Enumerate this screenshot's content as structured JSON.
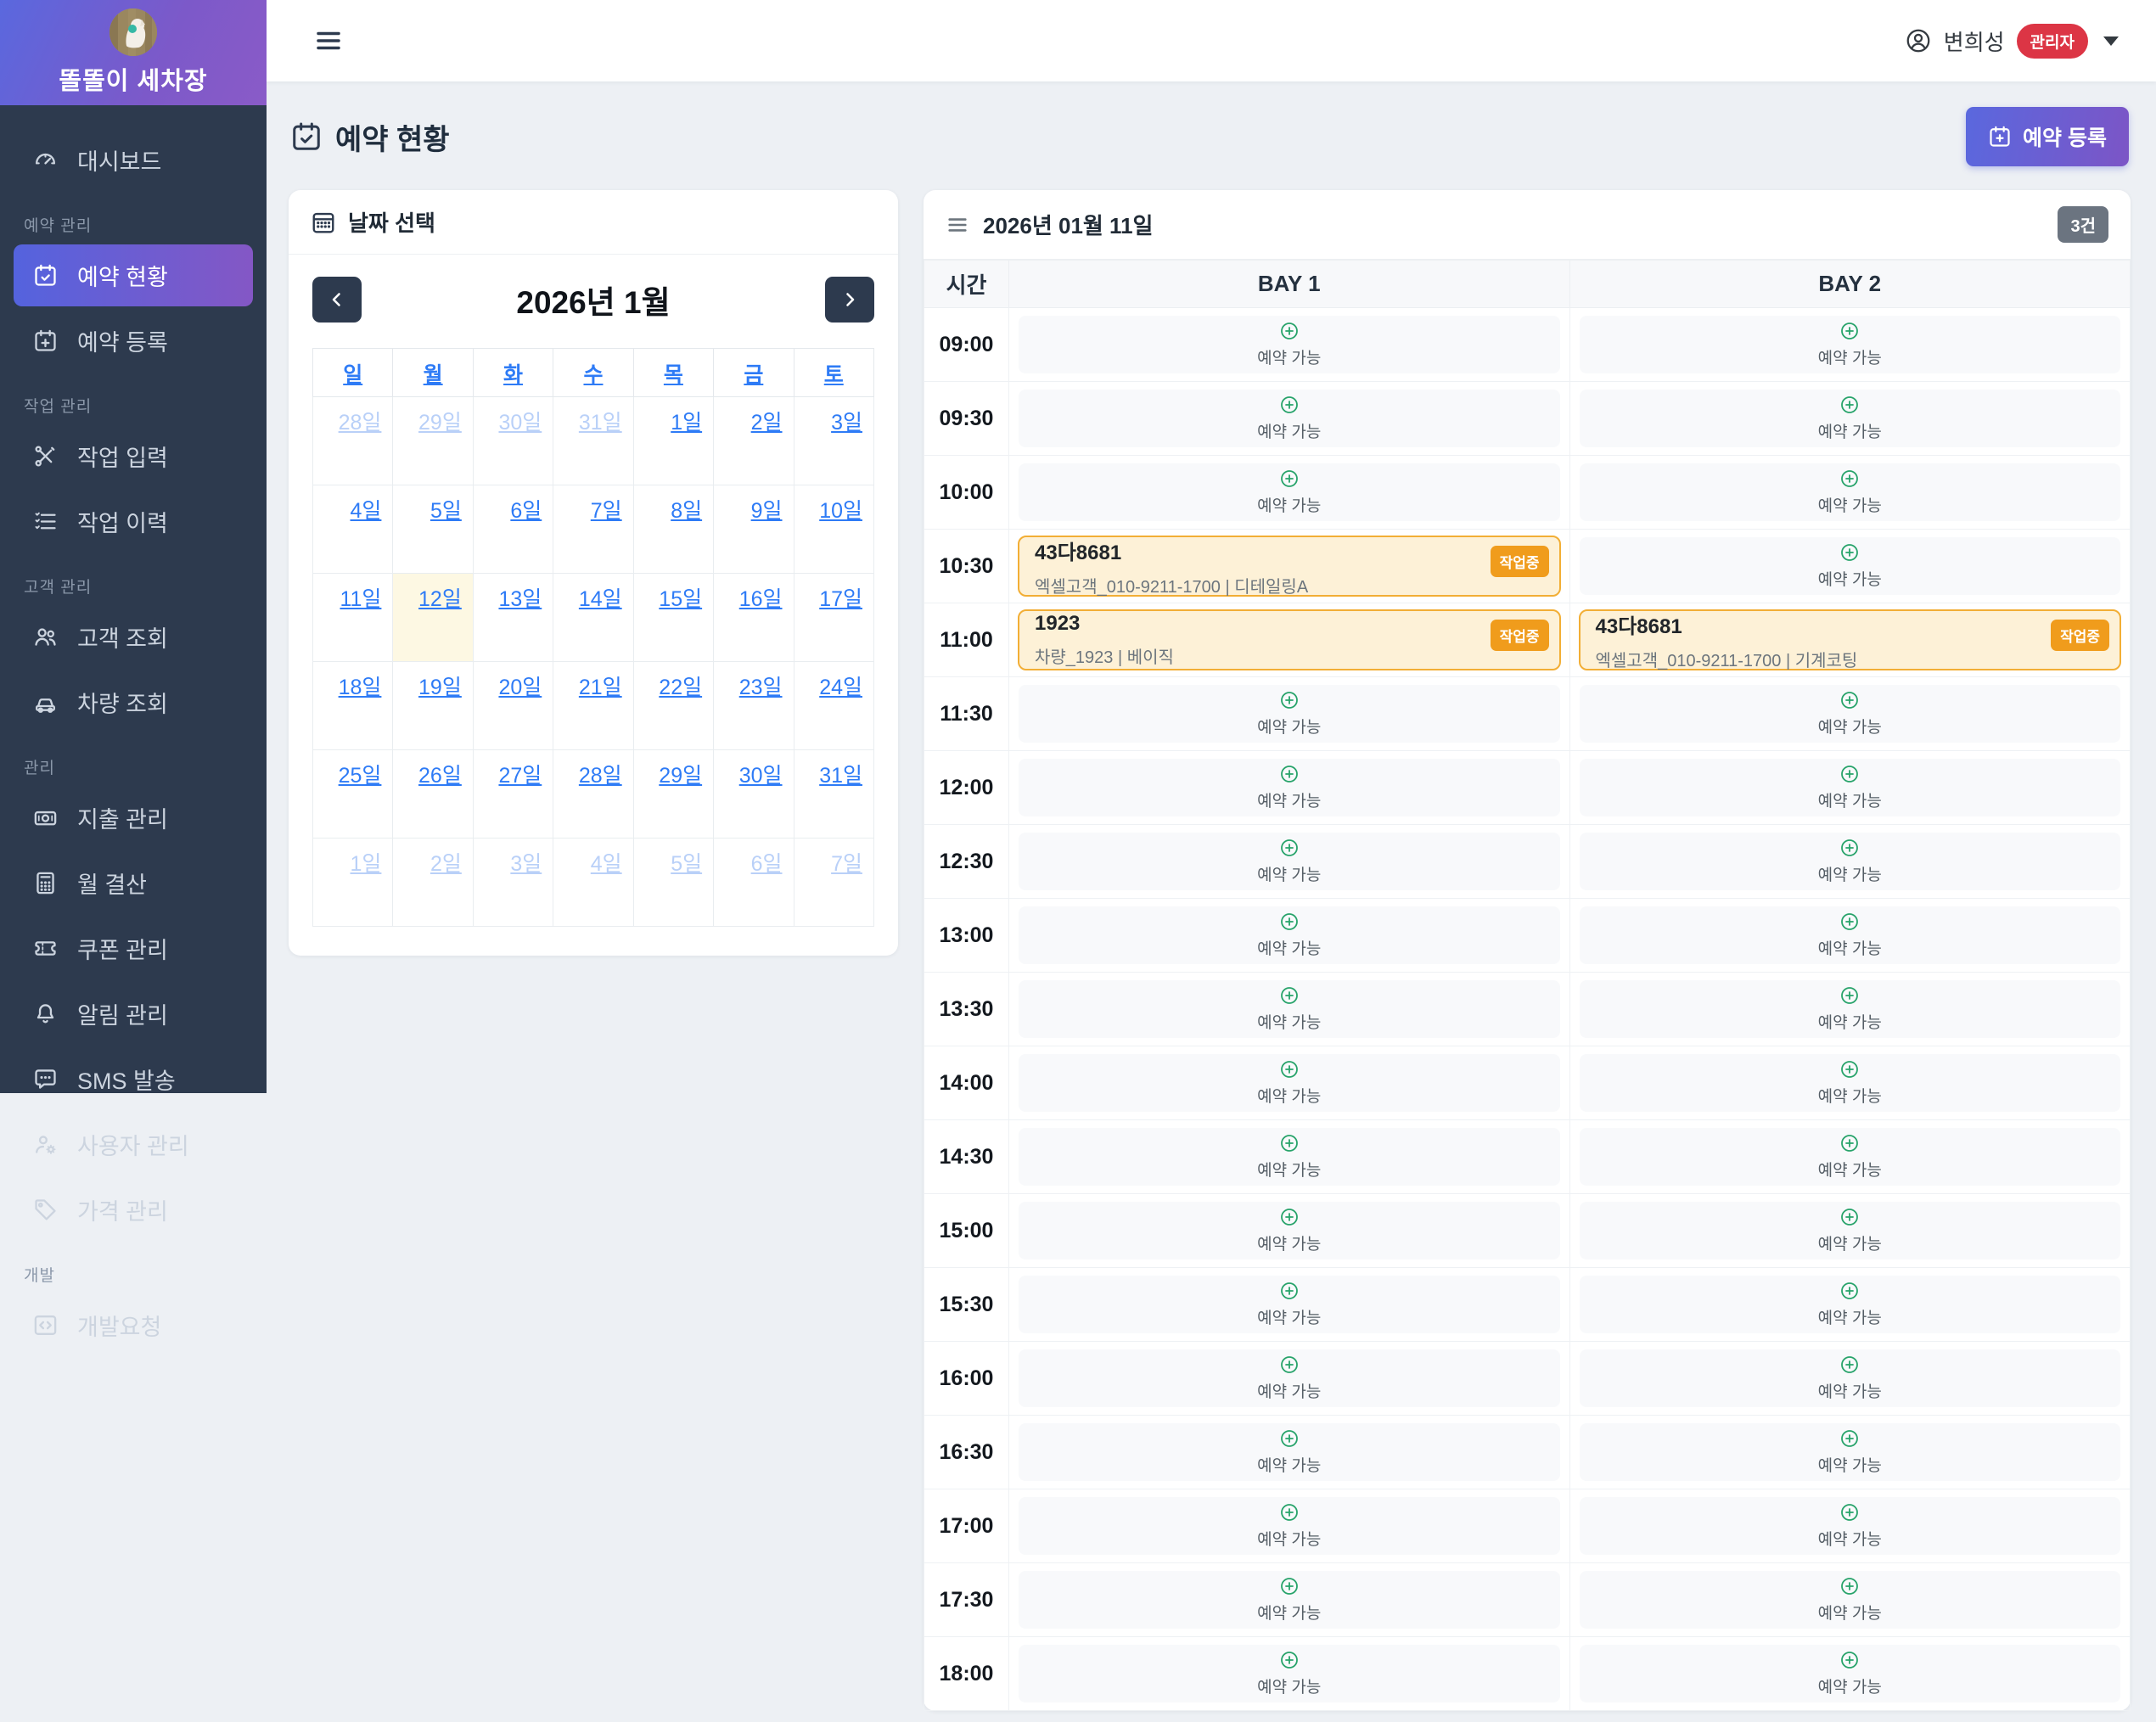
{
  "app": {
    "name": "똘똘이 세차장"
  },
  "topbar": {
    "user_name": "변희성",
    "user_role": "관리자"
  },
  "page": {
    "title": "예약 현황",
    "register_button": "예약 등록"
  },
  "sidebar": {
    "sections": [
      {
        "label": "",
        "items": [
          {
            "label": "대시보드",
            "icon": "dashboard-icon",
            "active": false
          }
        ]
      },
      {
        "label": "예약 관리",
        "items": [
          {
            "label": "예약 현황",
            "icon": "calendar-check-icon",
            "active": true
          },
          {
            "label": "예약 등록",
            "icon": "calendar-plus-icon",
            "active": false
          }
        ]
      },
      {
        "label": "작업 관리",
        "items": [
          {
            "label": "작업 입력",
            "icon": "tools-icon",
            "active": false
          },
          {
            "label": "작업 이력",
            "icon": "history-list-icon",
            "active": false
          }
        ]
      },
      {
        "label": "고객 관리",
        "items": [
          {
            "label": "고객 조회",
            "icon": "people-icon",
            "active": false
          },
          {
            "label": "차량 조회",
            "icon": "car-icon",
            "active": false
          }
        ]
      },
      {
        "label": "관리",
        "items": [
          {
            "label": "지출 관리",
            "icon": "money-icon",
            "active": false
          },
          {
            "label": "월 결산",
            "icon": "calculator-icon",
            "active": false
          },
          {
            "label": "쿠폰 관리",
            "icon": "ticket-icon",
            "active": false
          },
          {
            "label": "알림 관리",
            "icon": "bell-icon",
            "active": false
          },
          {
            "label": "SMS 발송",
            "icon": "chat-icon",
            "active": false
          },
          {
            "label": "사용자 관리",
            "icon": "user-gear-icon",
            "active": false
          },
          {
            "label": "가격 관리",
            "icon": "tag-icon",
            "active": false
          }
        ]
      },
      {
        "label": "개발",
        "items": [
          {
            "label": "개발요청",
            "icon": "code-icon",
            "active": false
          }
        ]
      }
    ]
  },
  "calendar": {
    "panel_title": "날짜 선택",
    "month_title": "2026년 1월",
    "weekdays": [
      "일",
      "월",
      "화",
      "수",
      "목",
      "금",
      "토"
    ],
    "weeks": [
      [
        {
          "label": "28일",
          "muted": true
        },
        {
          "label": "29일",
          "muted": true
        },
        {
          "label": "30일",
          "muted": true
        },
        {
          "label": "31일",
          "muted": true
        },
        {
          "label": "1일"
        },
        {
          "label": "2일"
        },
        {
          "label": "3일"
        }
      ],
      [
        {
          "label": "4일"
        },
        {
          "label": "5일"
        },
        {
          "label": "6일"
        },
        {
          "label": "7일"
        },
        {
          "label": "8일"
        },
        {
          "label": "9일"
        },
        {
          "label": "10일"
        }
      ],
      [
        {
          "label": "11일"
        },
        {
          "label": "12일",
          "today": true
        },
        {
          "label": "13일"
        },
        {
          "label": "14일"
        },
        {
          "label": "15일"
        },
        {
          "label": "16일"
        },
        {
          "label": "17일"
        }
      ],
      [
        {
          "label": "18일"
        },
        {
          "label": "19일"
        },
        {
          "label": "20일"
        },
        {
          "label": "21일"
        },
        {
          "label": "22일"
        },
        {
          "label": "23일"
        },
        {
          "label": "24일"
        }
      ],
      [
        {
          "label": "25일"
        },
        {
          "label": "26일"
        },
        {
          "label": "27일"
        },
        {
          "label": "28일"
        },
        {
          "label": "29일"
        },
        {
          "label": "30일"
        },
        {
          "label": "31일"
        }
      ],
      [
        {
          "label": "1일",
          "muted": true
        },
        {
          "label": "2일",
          "muted": true
        },
        {
          "label": "3일",
          "muted": true
        },
        {
          "label": "4일",
          "muted": true
        },
        {
          "label": "5일",
          "muted": true
        },
        {
          "label": "6일",
          "muted": true
        },
        {
          "label": "7일",
          "muted": true
        }
      ]
    ]
  },
  "schedule": {
    "date_title": "2026년 01월 11일",
    "count_badge": "3건",
    "columns": [
      "시간",
      "BAY 1",
      "BAY 2"
    ],
    "available_label": "예약 가능",
    "working_label": "작업중",
    "rows": [
      {
        "time": "09:00",
        "bay1": null,
        "bay2": null
      },
      {
        "time": "09:30",
        "bay1": null,
        "bay2": null
      },
      {
        "time": "10:00",
        "bay1": null,
        "bay2": null
      },
      {
        "time": "10:30",
        "bay1": {
          "title": "43다8681",
          "subtitle": "엑셀고객_010-9211-1700 | 디테일링A",
          "status": "작업중"
        },
        "bay2": null
      },
      {
        "time": "11:00",
        "bay1": {
          "title": "1923",
          "subtitle": "차량_1923 | 베이직",
          "status": "작업중"
        },
        "bay2": {
          "title": "43다8681",
          "subtitle": "엑셀고객_010-9211-1700 | 기계코팅",
          "status": "작업중"
        }
      },
      {
        "time": "11:30",
        "bay1": null,
        "bay2": null
      },
      {
        "time": "12:00",
        "bay1": null,
        "bay2": null
      },
      {
        "time": "12:30",
        "bay1": null,
        "bay2": null
      },
      {
        "time": "13:00",
        "bay1": null,
        "bay2": null
      },
      {
        "time": "13:30",
        "bay1": null,
        "bay2": null
      },
      {
        "time": "14:00",
        "bay1": null,
        "bay2": null
      },
      {
        "time": "14:30",
        "bay1": null,
        "bay2": null
      },
      {
        "time": "15:00",
        "bay1": null,
        "bay2": null
      },
      {
        "time": "15:30",
        "bay1": null,
        "bay2": null
      },
      {
        "time": "16:00",
        "bay1": null,
        "bay2": null
      },
      {
        "time": "16:30",
        "bay1": null,
        "bay2": null
      },
      {
        "time": "17:00",
        "bay1": null,
        "bay2": null
      },
      {
        "time": "17:30",
        "bay1": null,
        "bay2": null
      },
      {
        "time": "18:00",
        "bay1": null,
        "bay2": null
      }
    ]
  },
  "colors": {
    "sidebar_bg": "#2d3a4e",
    "accent_gradient_start": "#5a68de",
    "accent_gradient_end": "#8a5bc8",
    "link_blue": "#2e7bf6",
    "muted_link_blue": "#b9d0f8",
    "today_yellow": "#fdf8e3",
    "booked_bg": "#fdf1d7",
    "booked_border": "#f2ae35",
    "working_badge": "#f09c1c",
    "available_green": "#27a36a",
    "role_badge_red": "#dc3545",
    "count_badge_gray": "#6b7480"
  }
}
